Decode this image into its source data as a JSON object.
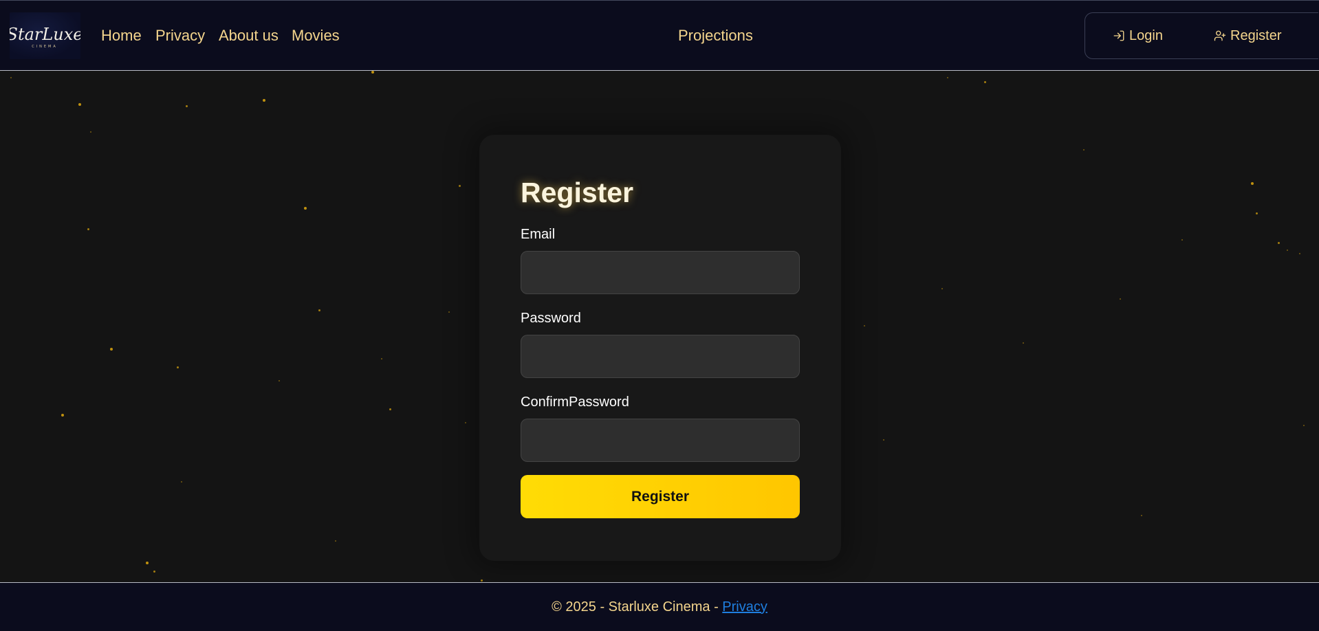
{
  "header": {
    "logo_text": "StarLuxe",
    "logo_subtext": "CINEMA",
    "nav": {
      "home": "Home",
      "privacy": "Privacy",
      "about": "About us",
      "movies": "Movies",
      "projections": "Projections"
    },
    "auth": {
      "login": "Login",
      "register": "Register"
    }
  },
  "form": {
    "title": "Register",
    "email_label": "Email",
    "email_value": "",
    "password_label": "Password",
    "password_value": "",
    "confirm_label": "ConfirmPassword",
    "confirm_value": "",
    "submit_label": "Register"
  },
  "footer": {
    "text": "© 2025 - Starluxe Cinema - ",
    "privacy_link": "Privacy"
  },
  "colors": {
    "nav_bg": "#0b0c1d",
    "nav_text": "#f4d58d",
    "page_bg": "#141414",
    "card_bg": "#181818",
    "input_bg": "#2e2e2e",
    "button_gradient_start": "#ffdc05",
    "button_gradient_end": "#ffc600",
    "link_blue": "#1f7fe0",
    "star_gold": "#c8980f"
  }
}
